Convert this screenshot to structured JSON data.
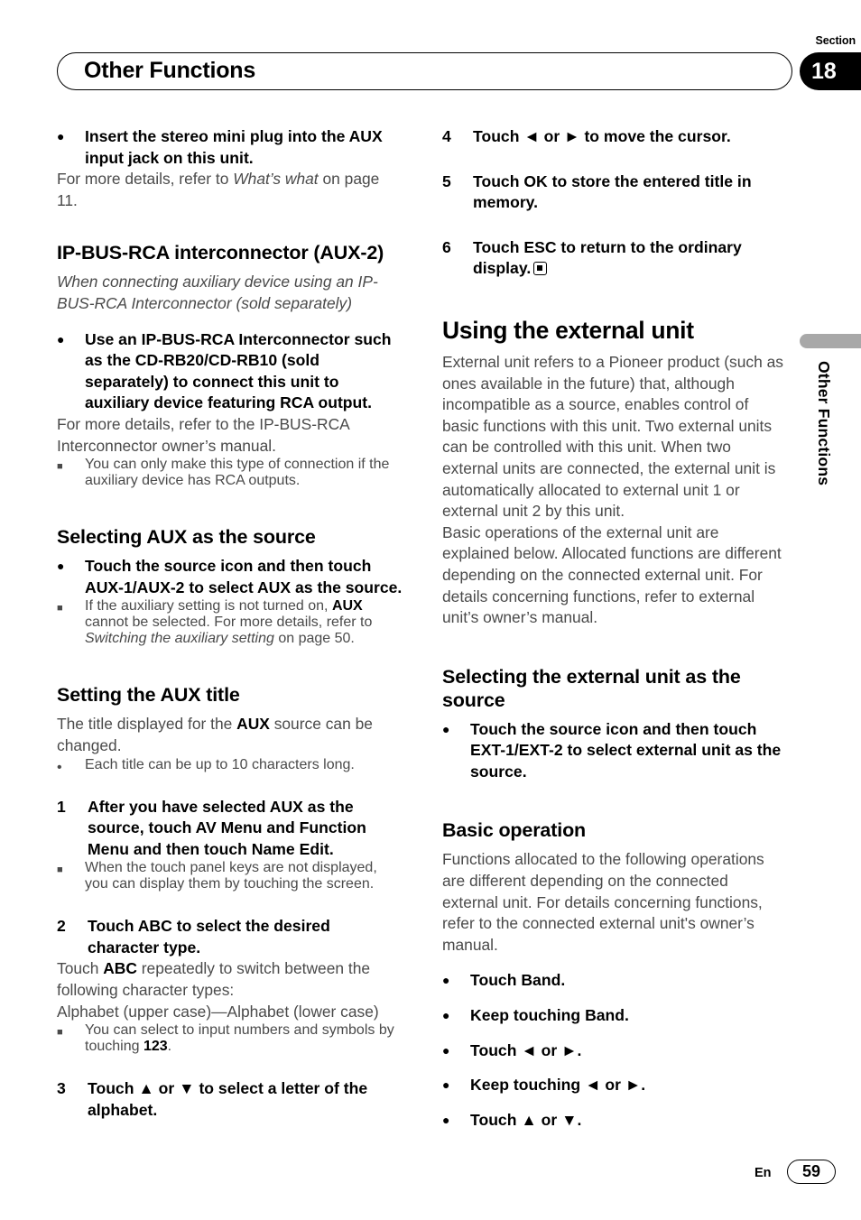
{
  "header": {
    "title": "Other Functions",
    "section_label": "Section",
    "section_number": "18"
  },
  "side_tab": {
    "text": "Other Functions"
  },
  "footer": {
    "language": "En",
    "page_number": "59"
  },
  "left_column": {
    "bullet_insert": {
      "glyph": "●",
      "text": "Insert the stereo mini plug into the AUX input jack on this unit."
    },
    "insert_note": {
      "lead": "For more details, refer to ",
      "italic": "What’s what",
      "tail": " on page 11."
    },
    "heading_ipbus": {
      "strong": "IP-BUS-RCA interconnector ",
      "light": "(AUX-2)"
    },
    "ipbus_italic": "When connecting auxiliary device using an IP-BUS-RCA Interconnector (sold separately)",
    "bullet_use": {
      "glyph": "●",
      "text": "Use an IP-BUS-RCA Interconnector such as the CD-RB20/CD-RB10 (sold separately) to connect this unit to auxiliary device featuring RCA output."
    },
    "use_note": "For more details, refer to the IP-BUS-RCA Interconnector owner’s manual.",
    "use_subnote": {
      "glyph": "■",
      "text": "You can only make this type of connection if the auxiliary device has RCA outputs."
    },
    "heading_selecting_aux": "Selecting AUX as the source",
    "bullet_touch_source": {
      "glyph": "●",
      "text": "Touch the source icon and then touch AUX-1/AUX-2 to select AUX as the source."
    },
    "aux_note": {
      "glyph": "■",
      "part1": "If the auxiliary setting is not turned on, ",
      "bold1": "AUX",
      "part2": " cannot be selected. For more details, refer to ",
      "italic1": "Switching the auxiliary setting",
      "part3": " on page 50."
    },
    "heading_setting_title": "Setting the AUX title",
    "title_intro": {
      "part1": "The title displayed for the ",
      "bold1": "AUX",
      "part2": " source can be changed."
    },
    "title_subnote": {
      "glyph": "•",
      "text": "Each title can be up to 10 characters long."
    },
    "step1": {
      "number": "1",
      "text": "After you have selected AUX as the source, touch AV Menu and Function Menu and then touch Name Edit."
    },
    "step1_note": {
      "glyph": "■",
      "text": "When the touch panel keys are not displayed, you can display them by touching the screen."
    },
    "step2": {
      "number": "2",
      "text": "Touch ABC to select the desired character type."
    },
    "step2_body": {
      "part1": "Touch ",
      "bold1": "ABC",
      "part2": " repeatedly to switch between the following character types:"
    },
    "step2_types": "Alphabet (upper case)—Alphabet (lower case)",
    "step2_note": {
      "glyph": "■",
      "part1": "You can select to input numbers and symbols by touching ",
      "bold1": "123",
      "part2": "."
    },
    "step3": {
      "number": "3",
      "text": "Touch ▲ or ▼ to select a letter of the alphabet."
    }
  },
  "right_column": {
    "step4": {
      "number": "4",
      "text": "Touch ◄ or ► to move the cursor."
    },
    "step5": {
      "number": "5",
      "text": "Touch OK to store the entered title in memory."
    },
    "step6": {
      "number": "6",
      "text": "Touch ESC to return to the ordinary display."
    },
    "heading_using_external": "Using the external unit",
    "external_body1": "External unit refers to a Pioneer product (such as ones available in the future) that, although incompatible as a source, enables control of basic functions with this unit. Two external units can be controlled with this unit. When two external units are connected, the external unit is automatically allocated to external unit 1 or external unit 2 by this unit.",
    "external_body2": "Basic operations of the external unit are explained below. Allocated functions are different depending on the connected external unit. For details concerning functions, refer to external unit’s owner’s manual.",
    "heading_selecting_external": "Selecting the external unit as the source",
    "bullet_touch_ext": {
      "glyph": "●",
      "text": "Touch the source icon and then touch EXT-1/EXT-2 to select external unit as the source."
    },
    "heading_basic_operation": "Basic operation",
    "basic_body": "Functions allocated to the following operations are different depending on the connected external unit. For details concerning functions, refer to the connected external unit's owner’s manual.",
    "operations": [
      {
        "glyph": "●",
        "text": "Touch Band."
      },
      {
        "glyph": "●",
        "text": "Keep touching Band."
      },
      {
        "glyph": "●",
        "text": "Touch ◄ or ►."
      },
      {
        "glyph": "●",
        "text": "Keep touching ◄ or ►."
      },
      {
        "glyph": "●",
        "text": "Touch ▲ or ▼."
      }
    ]
  }
}
